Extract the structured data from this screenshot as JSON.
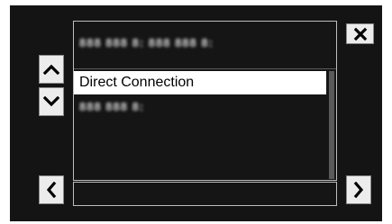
{
  "header": {
    "address_text": "888 888 8: 888 888 8:"
  },
  "list": {
    "items": [
      {
        "label": "Direct Connection",
        "selected": true
      },
      {
        "label": "888 888 8:",
        "selected": false,
        "obscured": true
      }
    ]
  },
  "buttons": {
    "up_icon": "chevron-up-icon",
    "down_icon": "chevron-down-icon",
    "back_icon": "chevron-left-icon",
    "next_icon": "chevron-right-icon",
    "close_icon": "close-icon"
  },
  "colors": {
    "background": "#141414",
    "button_face": "#ececec",
    "selection": "#ffffff",
    "panel_border": "#bdbdbd"
  }
}
